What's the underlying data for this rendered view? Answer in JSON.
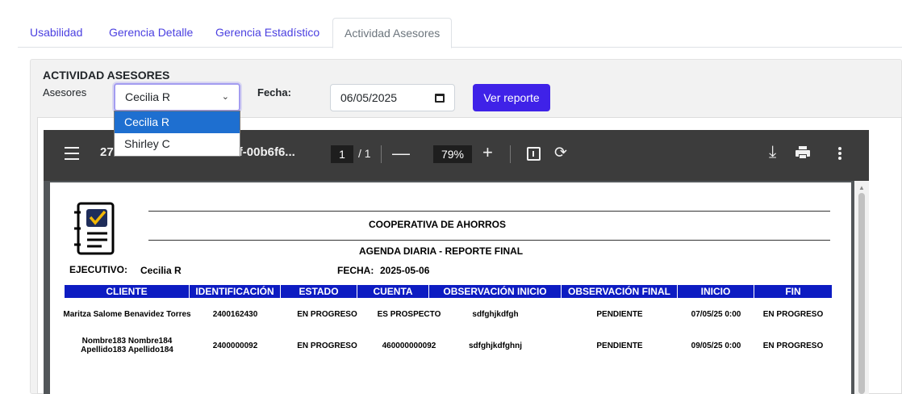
{
  "tabs": [
    {
      "label": "Usabilidad",
      "active": false
    },
    {
      "label": "Gerencia Detalle",
      "active": false
    },
    {
      "label": "Gerencia Estadístico",
      "active": false
    },
    {
      "label": "Actividad Asesores",
      "active": true
    }
  ],
  "panel": {
    "title": "ACTIVIDAD ASESORES",
    "asesores_label": "Asesores",
    "asesores_selected": "Cecilia R",
    "asesores_options": [
      "Cecilia R",
      "Shirley C"
    ],
    "fecha_label": "Fecha:",
    "fecha_value": "06/05/2025",
    "ver_reporte": "Ver reporte"
  },
  "viewer": {
    "doc_title": "27527f49-9ca0-49a9-bb6f-00b6f6...",
    "page_current": "1",
    "page_total": "/ 1",
    "zoom": "79%",
    "minus": "—",
    "plus": "+"
  },
  "report": {
    "org": "COOPERATIVA DE AHORROS",
    "subtitle": "AGENDA DIARIA - REPORTE FINAL",
    "ejecutivo_label": "EJECUTIVO:",
    "ejecutivo_value": "Cecilia R",
    "fecha_label": "FECHA:",
    "fecha_value": "2025-05-06",
    "columns": [
      "CLIENTE",
      "IDENTIFICACIÓN",
      "ESTADO",
      "CUENTA",
      "OBSERVACIÓN INICIO",
      "OBSERVACIÓN FINAL",
      "INICIO",
      "FIN"
    ],
    "rows": [
      {
        "cliente_1": "Maritza Salome Benavidez Torres",
        "cliente_2": "",
        "identificacion": "2400162430",
        "estado": "EN PROGRESO",
        "cuenta": "ES PROSPECTO",
        "obs_inicio": "sdfghjkdfgh",
        "obs_final": "PENDIENTE",
        "inicio": "07/05/25 0:00",
        "fin": "EN PROGRESO"
      },
      {
        "cliente_1": "Nombre183 Nombre184",
        "cliente_2": "Apellido183 Apellido184",
        "identificacion": "2400000092",
        "estado": "EN PROGRESO",
        "cuenta": "460000000092",
        "obs_inicio": "sdfghjkdfghnj",
        "obs_final": "PENDIENTE",
        "inicio": "09/05/25 0:00",
        "fin": "EN PROGRESO"
      }
    ]
  },
  "colors": {
    "tab_link": "#4a3fe0",
    "primary_button": "#3f22e8",
    "table_header": "#0d1cc2",
    "dropdown_selected": "#1e6fd0",
    "toolbar": "#3c3c3c"
  }
}
